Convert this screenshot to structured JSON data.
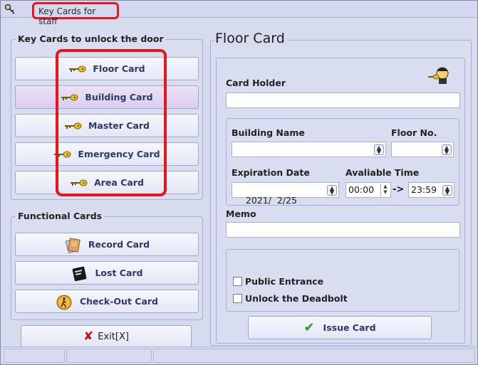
{
  "window": {
    "title": "Key Cards for staff"
  },
  "key_cards": {
    "group_title": "Key Cards to unlock the door",
    "items": [
      {
        "label": "Floor Card"
      },
      {
        "label": "Building Card"
      },
      {
        "label": "Master Card"
      },
      {
        "label": "Emergency Card"
      },
      {
        "label": "Area Card"
      }
    ]
  },
  "functional_cards": {
    "group_title": "Functional Cards",
    "items": [
      {
        "label": "Record Card"
      },
      {
        "label": "Lost Card"
      },
      {
        "label": "Check-Out Card"
      }
    ]
  },
  "exit_button": {
    "label": "Exit[X]"
  },
  "panel": {
    "title": "Floor Card",
    "card_holder_label": "Card Holder",
    "card_holder_value": "",
    "building_name_label": "Building Name",
    "building_name_value": "",
    "floor_no_label": "Floor No.",
    "floor_no_value": "",
    "expiration_date_label": "Expiration Date",
    "expiration_date_value": "2021/  2/25",
    "available_time_label": "Avaliable Time",
    "time_start": "00:00",
    "time_arrow": "->",
    "time_end": "23:59",
    "memo_label": "Memo",
    "memo_value": "",
    "public_entrance_label": "Public Entrance",
    "public_entrance_checked": false,
    "unlock_deadbolt_label": "Unlock the Deadbolt",
    "unlock_deadbolt_checked": false,
    "issue_button_label": "Issue Card"
  },
  "colors": {
    "highlight_red": "#e8151b",
    "button_text": "#2b3a6b",
    "active_button": "#dbcdee",
    "check_green": "#2a9a2a",
    "exit_red": "#c8141a"
  }
}
